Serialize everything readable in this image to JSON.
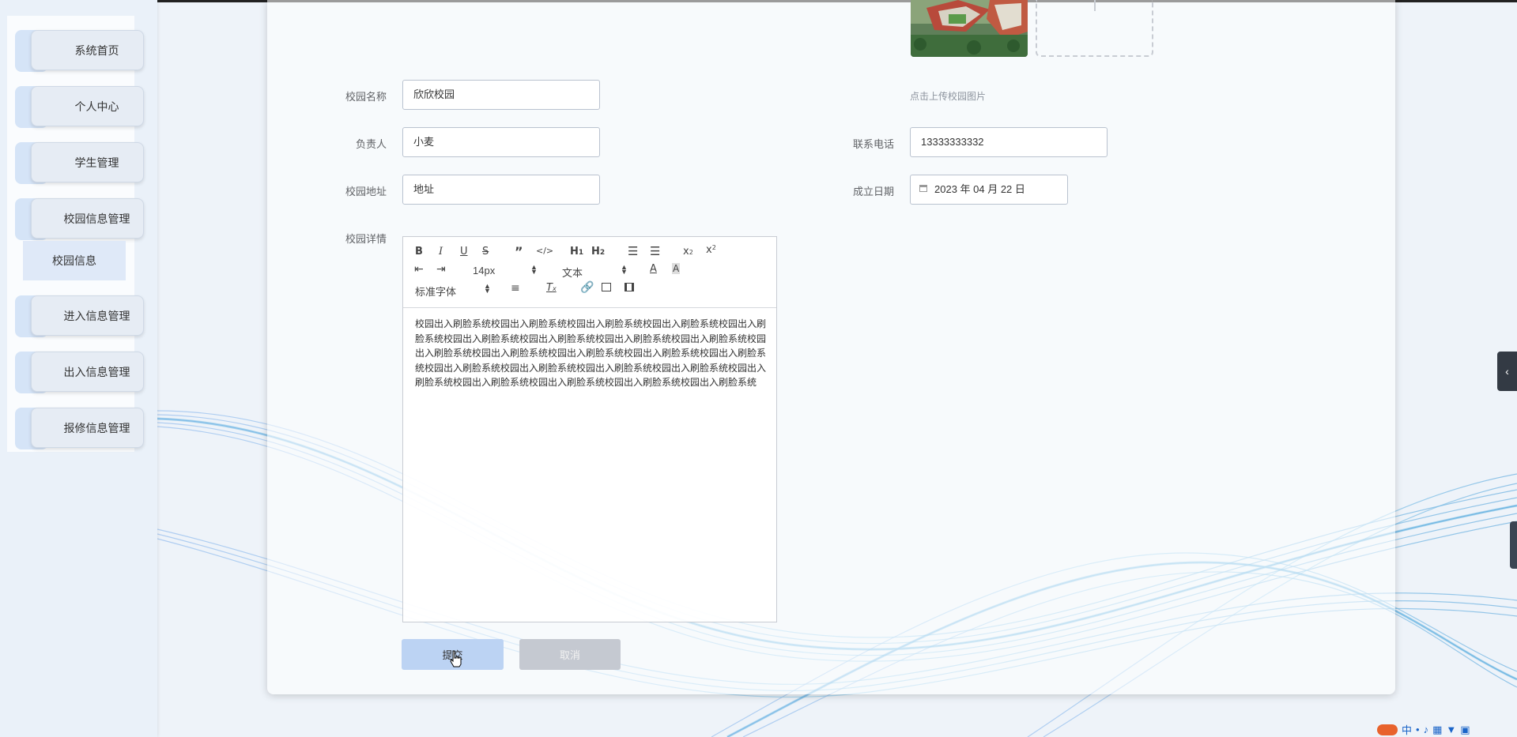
{
  "sidebar": {
    "items": [
      {
        "label": "系统首页"
      },
      {
        "label": "个人中心"
      },
      {
        "label": "学生管理"
      },
      {
        "label": "校园信息管理"
      },
      {
        "label": "进入信息管理"
      },
      {
        "label": "出入信息管理"
      },
      {
        "label": "报修信息管理"
      }
    ],
    "submenu_label": "校园信息"
  },
  "form": {
    "campus_name_label": "校园名称",
    "campus_name_value": "欣欣校园",
    "manager_label": "负责人",
    "manager_value": "小麦",
    "phone_label": "联系电话",
    "phone_value": "13333333332",
    "address_label": "校园地址",
    "address_value": "地址",
    "date_label": "成立日期",
    "date_value": "2023 年 04 月 22 日",
    "detail_label": "校园详情",
    "upload_tip": "点击上传校园图片"
  },
  "editor": {
    "font_size": "14px",
    "text_type": "文本",
    "font_family": "标准字体",
    "content": "校园出入刷脸系统校园出入刷脸系统校园出入刷脸系统校园出入刷脸系统校园出入刷脸系统校园出入刷脸系统校园出入刷脸系统校园出入刷脸系统校园出入刷脸系统校园出入刷脸系统校园出入刷脸系统校园出入刷脸系统校园出入刷脸系统校园出入刷脸系统校园出入刷脸系统校园出入刷脸系统校园出入刷脸系统校园出入刷脸系统校园出入刷脸系统校园出入刷脸系统校园出入刷脸系统校园出入刷脸系统校园出入刷脸系统"
  },
  "actions": {
    "submit_label": "提交",
    "cancel_label": "取消"
  },
  "colors": {
    "accent": "#bcd3f3",
    "wave": "#2f8fd8"
  }
}
